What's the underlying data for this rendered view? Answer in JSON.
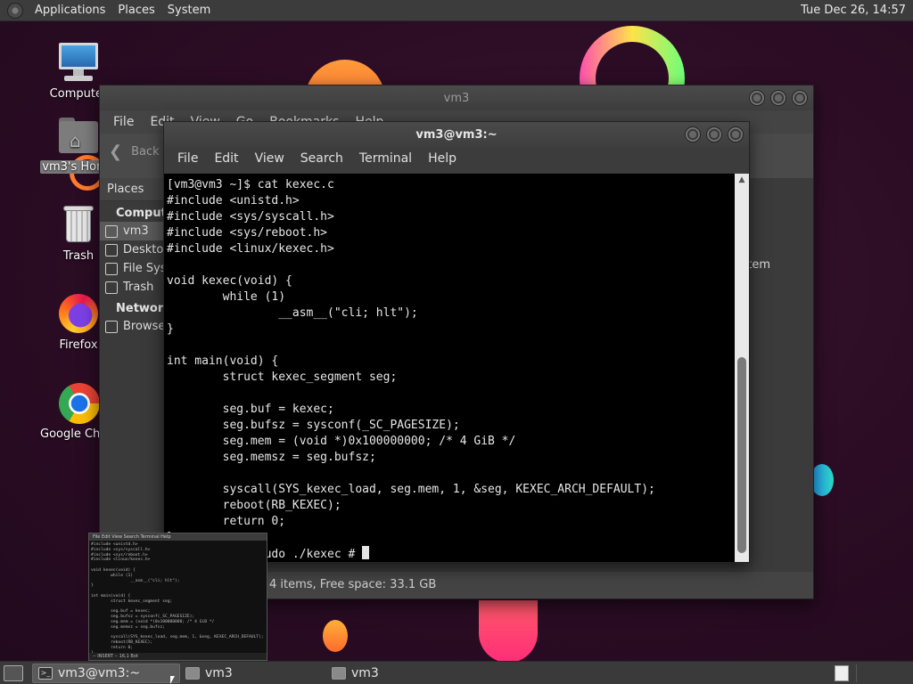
{
  "top_panel": {
    "menus": [
      "Applications",
      "Places",
      "System"
    ],
    "clock": "Tue Dec 26, 14:57"
  },
  "desktop_icons": [
    {
      "label": "Computer",
      "icon": "computer-icon"
    },
    {
      "label": "vm3's Home",
      "icon": "home-folder-icon",
      "selected": true
    },
    {
      "label": "Trash",
      "icon": "trash-icon"
    },
    {
      "label": "Firefox",
      "icon": "firefox-icon"
    },
    {
      "label": "Google Chrome",
      "icon": "chrome-icon"
    }
  ],
  "file_manager": {
    "title": "vm3",
    "menu_visible": [
      "File",
      "Edit",
      "View",
      "Go",
      "Bookmarks",
      "Help"
    ],
    "toolbar_back": "Back",
    "sidebar_header": "Places",
    "sidebar_sections": [
      {
        "title": "Computer",
        "items": [
          "vm3",
          "Desktop",
          "File System",
          "Trash"
        ]
      },
      {
        "title": "Network",
        "items": [
          "Browse Network"
        ]
      }
    ],
    "partial_item_label": "File System",
    "status": "4 items, Free space: 33.1 GB"
  },
  "terminal": {
    "title": "vm3@vm3:~",
    "menus": [
      "File",
      "Edit",
      "View",
      "Search",
      "Terminal",
      "Help"
    ],
    "lines": [
      "[vm3@vm3 ~]$ cat kexec.c",
      "#include <unistd.h>",
      "#include <sys/syscall.h>",
      "#include <sys/reboot.h>",
      "#include <linux/kexec.h>",
      "",
      "void kexec(void) {",
      "        while (1)",
      "                __asm__(\"cli; hlt\");",
      "}",
      "",
      "int main(void) {",
      "        struct kexec_segment seg;",
      "",
      "        seg.buf = kexec;",
      "        seg.bufsz = sysconf(_SC_PAGESIZE);",
      "        seg.mem = (void *)0x100000000; /* 4 GiB */",
      "        seg.memsz = seg.bufsz;",
      "",
      "        syscall(SYS_kexec_load, seg.mem, 1, &seg, KEXEC_ARCH_DEFAULT);",
      "        reboot(RB_KEXEC);",
      "        return 0;",
      "}"
    ],
    "prompt_line": "[vm3@vm3 ~]$ sudo ./kexec # "
  },
  "preview": {
    "menus": "File  Edit  View  Search  Terminal  Help",
    "status": "-- INSERT --                                  16,1        Bot"
  },
  "taskbar": {
    "tasks": [
      {
        "label": "vm3@vm3:~",
        "icon": "terminal-icon",
        "active": true
      },
      {
        "label": "vm3",
        "icon": "folder-icon",
        "active": false
      },
      {
        "label": "vm3",
        "icon": "folder-icon",
        "active": false
      }
    ]
  }
}
